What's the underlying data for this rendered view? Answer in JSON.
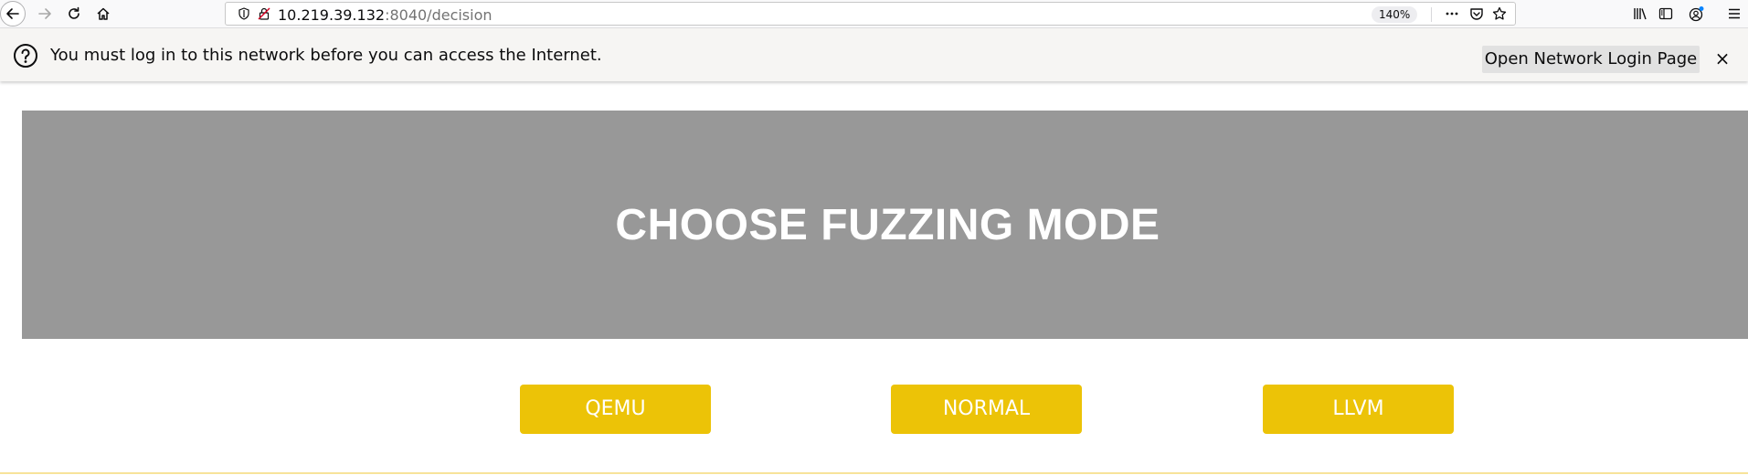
{
  "browser": {
    "url_host": "10.219.39.132",
    "url_path": ":8040/decision",
    "zoom": "140%"
  },
  "notification": {
    "message": "You must log in to this network before you can access the Internet.",
    "button_label": "Open Network Login Page",
    "close_label": "×"
  },
  "page": {
    "title": "CHOOSE FUZZING MODE",
    "modes": [
      "QEMU",
      "NORMAL",
      "LLVM"
    ]
  },
  "colors": {
    "hero_bg": "#989898",
    "mode_button": "#ecc307"
  }
}
